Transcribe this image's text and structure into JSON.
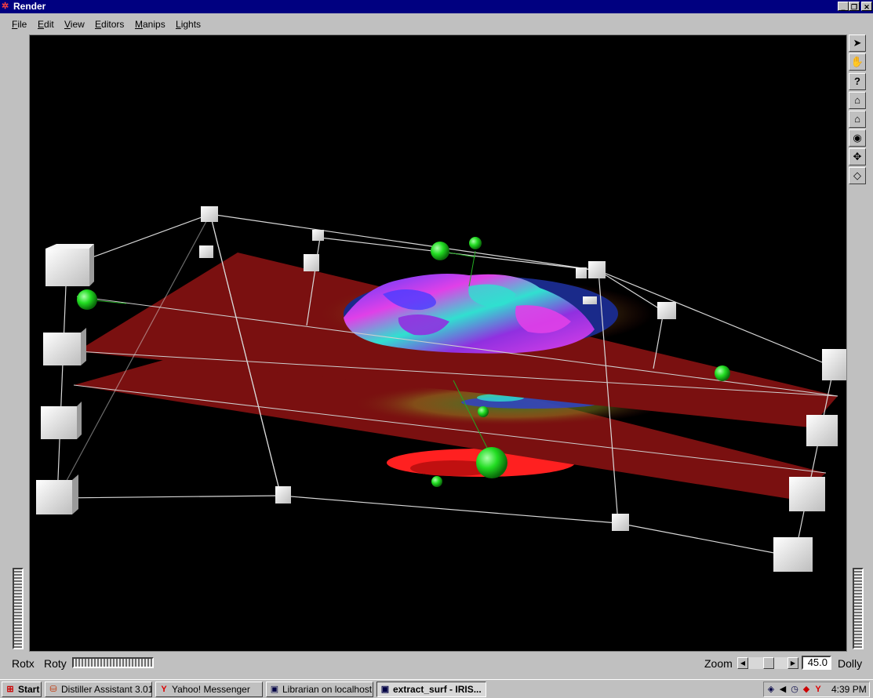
{
  "window": {
    "title": "Render"
  },
  "menu": [
    {
      "label": "File",
      "u": "F",
      "rest": "ile"
    },
    {
      "label": "Edit",
      "u": "E",
      "rest": "dit"
    },
    {
      "label": "View",
      "u": "V",
      "rest": "iew"
    },
    {
      "label": "Editors",
      "u": "E",
      "rest": "ditors"
    },
    {
      "label": "Manips",
      "u": "M",
      "rest": "anips"
    },
    {
      "label": "Lights",
      "u": "L",
      "rest": "ights"
    }
  ],
  "tools": [
    "arrow-pointer-icon",
    "hand-icon",
    "help-icon",
    "home-icon",
    "set-home-icon",
    "view-all-icon",
    "seek-icon",
    "perspective-icon"
  ],
  "tool_glyphs": [
    "➤",
    "✋",
    "?",
    "⌂",
    "⌂",
    "◉",
    "✥",
    "◇"
  ],
  "bottom": {
    "rotx": "Rotx",
    "roty": "Roty",
    "zoom": "Zoom",
    "zoom_value": "45.0",
    "dolly": "Dolly"
  },
  "taskbar": {
    "start": "Start",
    "items": [
      {
        "label": "Distiller Assistant 3.01",
        "icon": "distiller-icon"
      },
      {
        "label": "Yahoo! Messenger",
        "icon": "yahoo-icon"
      },
      {
        "label": "Librarian on localhost",
        "icon": "librarian-icon"
      },
      {
        "label": "extract_surf - IRIS...",
        "icon": "iris-icon",
        "active": true
      }
    ],
    "clock": "4:39 PM"
  },
  "colors": {
    "titlebar": "#000080",
    "plane": "#7a1010",
    "surface_blue": "#4a3cff",
    "surface_magenta": "#e040e8",
    "surface_cyan": "#30e0d0",
    "sphere": "#22dd22",
    "red_surface": "#ff2020"
  }
}
